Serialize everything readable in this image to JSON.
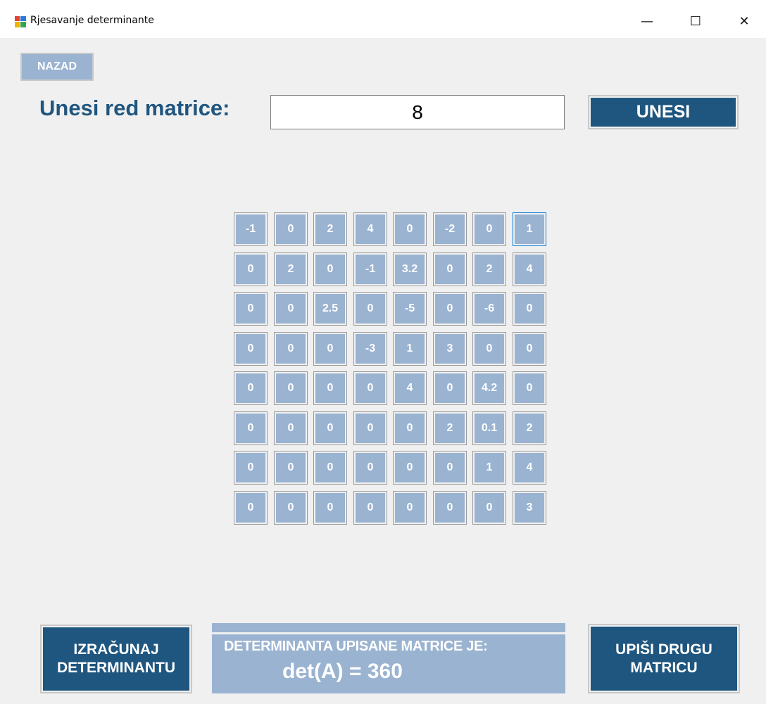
{
  "window": {
    "title": "Rjesavanje determinante",
    "minimize_glyph": "—",
    "maximize_glyph": "☐",
    "close_glyph": "✕"
  },
  "nav": {
    "back_label": "NAZAD"
  },
  "order": {
    "label": "Unesi red matrice:",
    "value": "8",
    "submit_label": "UNESI"
  },
  "matrix": {
    "size": 8,
    "cells": [
      [
        "-1",
        "0",
        "2",
        "4",
        "0",
        "-2",
        "0",
        "1"
      ],
      [
        "0",
        "2",
        "0",
        "-1",
        "3.2",
        "0",
        "2",
        "4"
      ],
      [
        "0",
        "0",
        "2.5",
        "0",
        "-5",
        "0",
        "-6",
        "0"
      ],
      [
        "0",
        "0",
        "0",
        "-3",
        "1",
        "3",
        "0",
        "0"
      ],
      [
        "0",
        "0",
        "0",
        "0",
        "4",
        "0",
        "4.2",
        "0"
      ],
      [
        "0",
        "0",
        "0",
        "0",
        "0",
        "2",
        "0.1",
        "2"
      ],
      [
        "0",
        "0",
        "0",
        "0",
        "0",
        "0",
        "1",
        "4"
      ],
      [
        "0",
        "0",
        "0",
        "0",
        "0",
        "0",
        "0",
        "3"
      ]
    ],
    "focused_cell": [
      0,
      7
    ]
  },
  "actions": {
    "calculate_line1": "IZRAČUNAJ",
    "calculate_line2": "DETERMINANTU",
    "new_line1": "UPIŠI DRUGU",
    "new_line2": "MATRICU"
  },
  "result": {
    "label": "DETERMINANTA UPISANE MATRICE JE:",
    "value": "det(A) = 360"
  },
  "colors": {
    "dark_blue": "#1f567f",
    "light_blue": "#9ab3d1",
    "background": "#f0f0f0"
  },
  "icons": {
    "app": "app-window-icon",
    "minimize": "minimize-icon",
    "maximize": "maximize-icon",
    "close": "close-icon"
  }
}
